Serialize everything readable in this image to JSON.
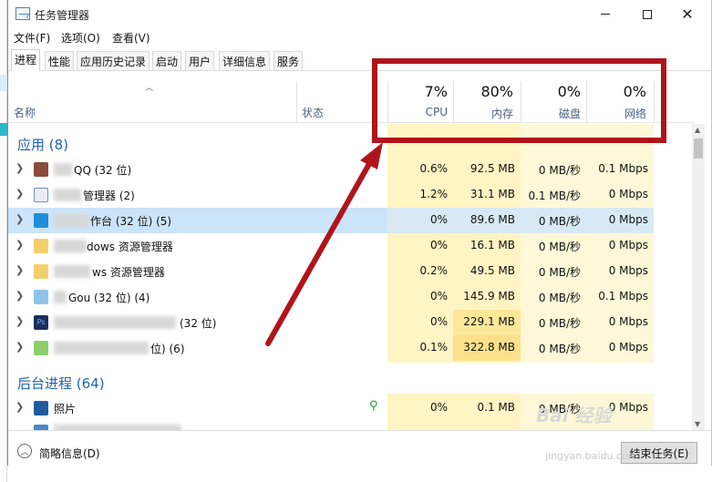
{
  "window": {
    "title": "任务管理器"
  },
  "menu": [
    "文件(F)",
    "选项(O)",
    "查看(V)"
  ],
  "tabs": [
    "进程",
    "性能",
    "应用历史记录",
    "启动",
    "用户",
    "详细信息",
    "服务"
  ],
  "columns": {
    "name": "名称",
    "status": "状态",
    "cpu": {
      "pct": "7%",
      "label": "CPU"
    },
    "mem": {
      "pct": "80%",
      "label": "内存"
    },
    "disk": {
      "pct": "0%",
      "label": "磁盘"
    },
    "net": {
      "pct": "0%",
      "label": "网络"
    }
  },
  "groups": {
    "apps": "应用 (8)",
    "background": "后台进程 (64)"
  },
  "apps": [
    {
      "name": "QQ (32 位)",
      "cpu": "0.6%",
      "mem": "92.5 MB",
      "disk": "0 MB/秒",
      "net": "0.1 Mbps"
    },
    {
      "name": "管理器 (2)",
      "cpu": "1.2%",
      "mem": "31.1 MB",
      "disk": "0.1 MB/秒",
      "net": "0 Mbps"
    },
    {
      "name": "作台 (32 位) (5)",
      "cpu": "0%",
      "mem": "89.6 MB",
      "disk": "0 MB/秒",
      "net": "0 Mbps"
    },
    {
      "name": "dows 资源管理器",
      "cpu": "0%",
      "mem": "16.1 MB",
      "disk": "0 MB/秒",
      "net": "0 Mbps"
    },
    {
      "name": "ws 资源管理器",
      "cpu": "0.2%",
      "mem": "49.5 MB",
      "disk": "0 MB/秒",
      "net": "0 Mbps"
    },
    {
      "name": "Gou (32 位) (4)",
      "cpu": "0%",
      "mem": "145.9 MB",
      "disk": "0 MB/秒",
      "net": "0.1 Mbps"
    },
    {
      "name": "(32 位)",
      "cpu": "0%",
      "mem": "229.1 MB",
      "disk": "0 MB/秒",
      "net": "0 Mbps"
    },
    {
      "name": "位) (6)",
      "cpu": "0.1%",
      "mem": "322.8 MB",
      "disk": "0 MB/秒",
      "net": "0 Mbps"
    }
  ],
  "background": [
    {
      "name": "照片",
      "cpu": "0%",
      "mem": "0.1 MB",
      "disk": "0 MB/秒",
      "net": "0 Mbps"
    }
  ],
  "footer": {
    "fewer_details": "简略信息(D)",
    "end_task": "结束任务(E)"
  },
  "watermark": {
    "brand": "Bai 经验",
    "url": "jingyan.baidu.com"
  },
  "colors": {
    "highlight": "#fff4c4",
    "selected_row": "#cce4f7",
    "annotation": "#b0141b",
    "group_text": "#2162b4"
  }
}
